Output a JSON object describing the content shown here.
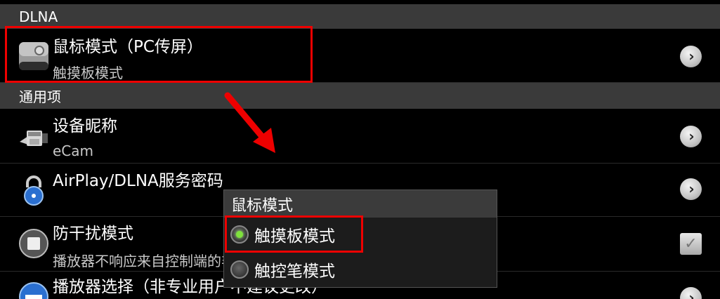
{
  "sections": {
    "dlna": "DLNA",
    "general": "通用项"
  },
  "rows": [
    {
      "title": "鼠标模式（PC传屏）",
      "subtitle": "触摸板模式",
      "icon": "speaker-icon",
      "control": "chevron"
    },
    {
      "title": "设备昵称",
      "subtitle": "eCam",
      "icon": "camcorder-icon",
      "control": "chevron"
    },
    {
      "title": "AirPlay/DLNA服务密码",
      "subtitle": "",
      "icon": "lock-icon",
      "control": "chevron"
    },
    {
      "title": "防干扰模式",
      "subtitle": "播放器不响应来自控制端的非播放指令",
      "icon": "stop-circle-icon",
      "control": "checkbox"
    },
    {
      "title": "播放器选择（非专业用户不建议更改）",
      "subtitle": "",
      "icon": "player-select-icon",
      "control": "chevron"
    }
  ],
  "popup": {
    "title": "鼠标模式",
    "options": [
      {
        "label": "触摸板模式",
        "selected": true
      },
      {
        "label": "触控笔模式",
        "selected": false
      }
    ]
  },
  "colors": {
    "highlight": "#ee0000",
    "radio_selected": "#7fe23c",
    "section_bg": "#3a3a3a"
  }
}
